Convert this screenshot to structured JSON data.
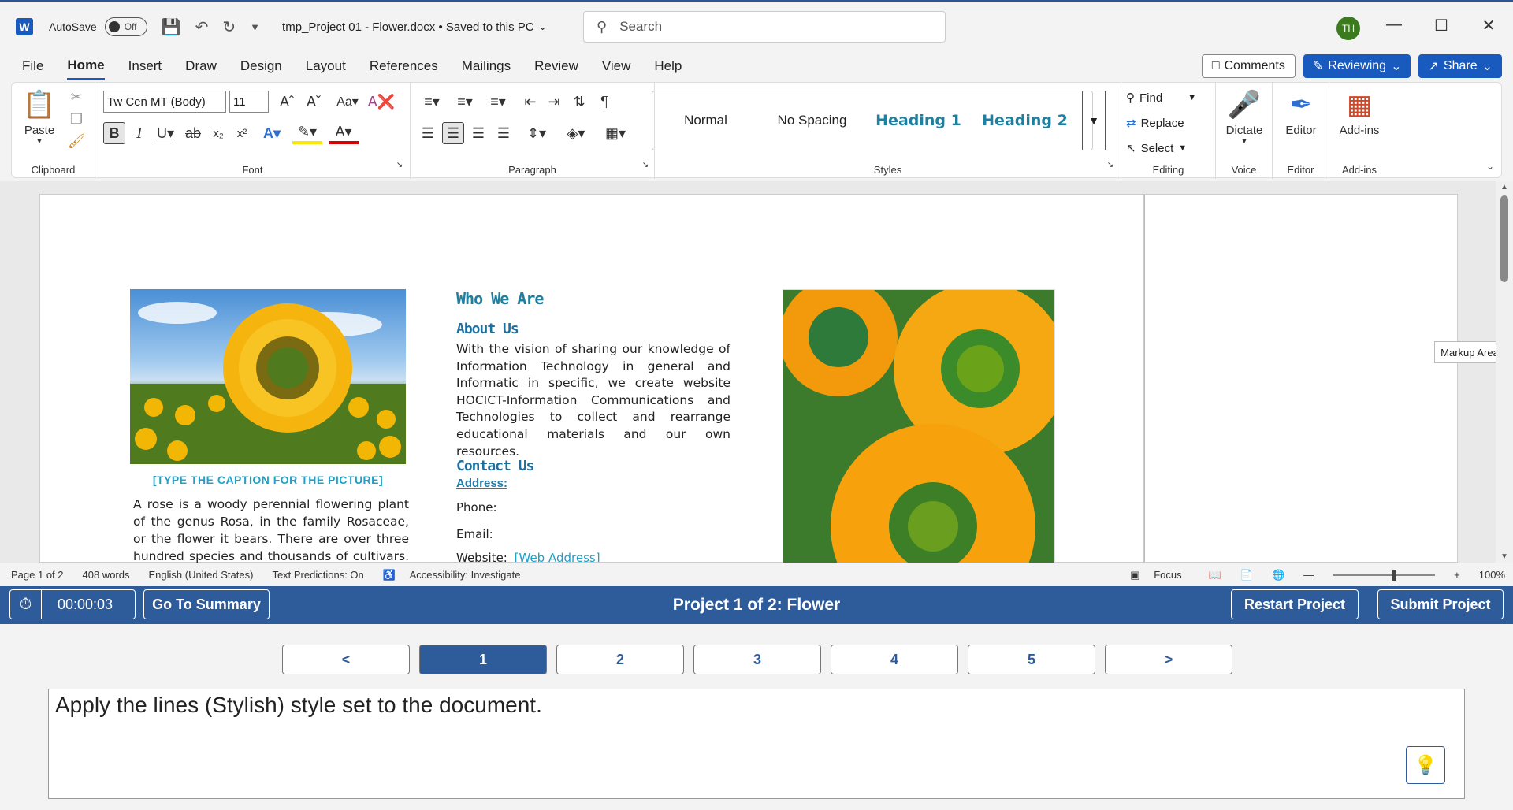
{
  "titlebar": {
    "autosave_label": "AutoSave",
    "autosave_state": "Off",
    "document_title": "tmp_Project 01 - Flower.docx • Saved to this PC",
    "search_placeholder": "Search",
    "avatar_initials": "TH"
  },
  "menu": {
    "tabs": [
      "File",
      "Home",
      "Insert",
      "Draw",
      "Design",
      "Layout",
      "References",
      "Mailings",
      "Review",
      "View",
      "Help"
    ],
    "active_tab": "Home",
    "comments_label": "Comments",
    "reviewing_label": "Reviewing",
    "share_label": "Share"
  },
  "ribbon": {
    "clipboard": {
      "paste_label": "Paste",
      "group_label": "Clipboard"
    },
    "font": {
      "font_name": "Tw Cen MT (Body)",
      "font_size": "11",
      "group_label": "Font"
    },
    "paragraph": {
      "group_label": "Paragraph"
    },
    "styles": {
      "items": [
        "Normal",
        "No Spacing",
        "Heading 1",
        "Heading 2"
      ],
      "group_label": "Styles"
    },
    "editing": {
      "find_label": "Find",
      "replace_label": "Replace",
      "select_label": "Select",
      "group_label": "Editing"
    },
    "voice": {
      "dictate_label": "Dictate",
      "group_label": "Voice"
    },
    "editor": {
      "editor_label": "Editor",
      "group_label": "Editor"
    },
    "addins": {
      "addins_label": "Add-ins",
      "group_label": "Add-ins"
    }
  },
  "document": {
    "caption": "[TYPE THE CAPTION FOR THE PICTURE]",
    "left_body": "A rose is a woody perennial flowering plant of the genus Rosa, in the family Rosaceae, or the flower it bears. There are over three hundred species and thousands of cultivars. They form a",
    "who_we_are": "Who We Are",
    "about_us": "About Us",
    "about_text": "With the vision of sharing our knowledge of Information Technology in general and Informatic in specific, we create website HOCICT-Information Communications and Technologies to collect and rearrange educational materials and our own resources.",
    "contact_us": "Contact Us",
    "address": "Address:",
    "phone": "Phone:",
    "email": "Email:",
    "website": "Website:",
    "web_address": "[Web Address]",
    "markup_tooltip": "Markup Area"
  },
  "status": {
    "page": "Page 1 of 2",
    "words": "408 words",
    "language": "English (United States)",
    "predictions": "Text Predictions: On",
    "accessibility": "Accessibility: Investigate",
    "focus": "Focus",
    "zoom": "100%"
  },
  "exam": {
    "timer": "00:00:03",
    "go_to_summary": "Go To Summary",
    "project_title": "Project 1 of 2: Flower",
    "restart": "Restart Project",
    "submit": "Submit Project"
  },
  "pager": {
    "prev": "<",
    "pages": [
      "1",
      "2",
      "3",
      "4",
      "5"
    ],
    "next": ">",
    "active_page": "1"
  },
  "task": {
    "instruction": "Apply the lines (Stylish) style set to the document."
  },
  "colors": {
    "accent": "#185abd",
    "exam_bar": "#2e5b99",
    "heading": "#1f7f9e"
  }
}
